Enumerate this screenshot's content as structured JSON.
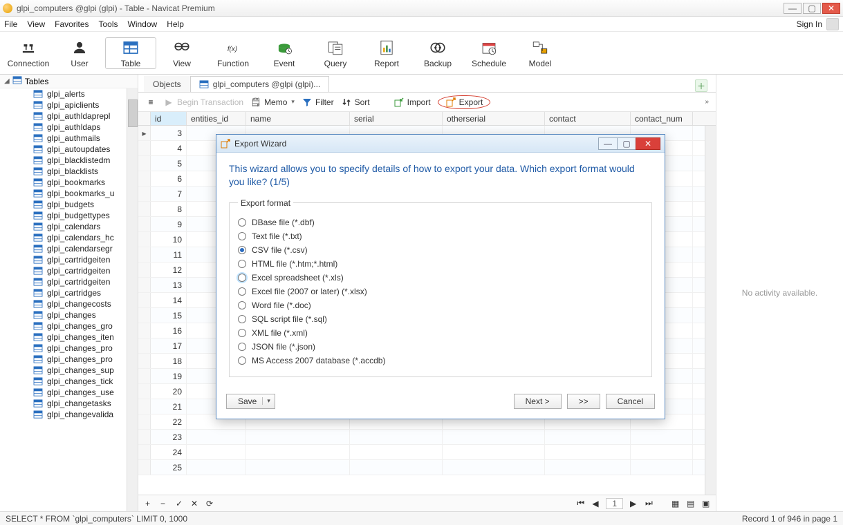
{
  "title": "glpi_computers @glpi (glpi) - Table - Navicat Premium",
  "menus": [
    "File",
    "View",
    "Favorites",
    "Tools",
    "Window",
    "Help"
  ],
  "signin": "Sign In",
  "ribbon": [
    {
      "label": "Connection"
    },
    {
      "label": "User"
    },
    {
      "label": "Table"
    },
    {
      "label": "View"
    },
    {
      "label": "Function"
    },
    {
      "label": "Event"
    },
    {
      "label": "Query"
    },
    {
      "label": "Report"
    },
    {
      "label": "Backup"
    },
    {
      "label": "Schedule"
    },
    {
      "label": "Model"
    }
  ],
  "nav_header": "Tables",
  "nav_items": [
    "glpi_alerts",
    "glpi_apiclients",
    "glpi_authldaprepl",
    "glpi_authldaps",
    "glpi_authmails",
    "glpi_autoupdates",
    "glpi_blacklistedm",
    "glpi_blacklists",
    "glpi_bookmarks",
    "glpi_bookmarks_u",
    "glpi_budgets",
    "glpi_budgettypes",
    "glpi_calendars",
    "glpi_calendars_hc",
    "glpi_calendarsegr",
    "glpi_cartridgeiten",
    "glpi_cartridgeiten",
    "glpi_cartridgeiten",
    "glpi_cartridges",
    "glpi_changecosts",
    "glpi_changes",
    "glpi_changes_gro",
    "glpi_changes_iten",
    "glpi_changes_pro",
    "glpi_changes_pro",
    "glpi_changes_sup",
    "glpi_changes_tick",
    "glpi_changes_use",
    "glpi_changetasks",
    "glpi_changevalida"
  ],
  "tabs": {
    "objects": "Objects",
    "current": "glpi_computers @glpi (glpi)..."
  },
  "actionbar": {
    "begin": "Begin Transaction",
    "memo": "Memo",
    "filter": "Filter",
    "sort": "Sort",
    "import": "Import",
    "export": "Export"
  },
  "columns": [
    "id",
    "entities_id",
    "name",
    "serial",
    "otherserial",
    "contact",
    "contact_num"
  ],
  "row_ids": [
    3,
    4,
    5,
    6,
    7,
    8,
    9,
    10,
    11,
    12,
    13,
    14,
    15,
    16,
    17,
    18,
    19,
    20,
    21,
    22,
    23,
    24,
    25
  ],
  "right_panel": "No activity available.",
  "status_query": "SELECT * FROM `glpi_computers` LIMIT 0, 1000",
  "status_record": "Record 1 of 946 in page 1",
  "page_indicator": "1",
  "dialog": {
    "title": "Export Wizard",
    "heading": "This wizard allows you to specify details of how to export your data. Which export format would you like? (1/5)",
    "legend": "Export format",
    "options": [
      "DBase file (*.dbf)",
      "Text file (*.txt)",
      "CSV file (*.csv)",
      "HTML file (*.htm;*.html)",
      "Excel spreadsheet (*.xls)",
      "Excel file (2007 or later) (*.xlsx)",
      "Word file (*.doc)",
      "SQL script file (*.sql)",
      "XML file (*.xml)",
      "JSON file (*.json)",
      "MS Access 2007 database (*.accdb)"
    ],
    "selected_index": 2,
    "hover_index": 4,
    "save": "Save",
    "next": "Next >",
    "skip": ">>",
    "cancel": "Cancel"
  }
}
